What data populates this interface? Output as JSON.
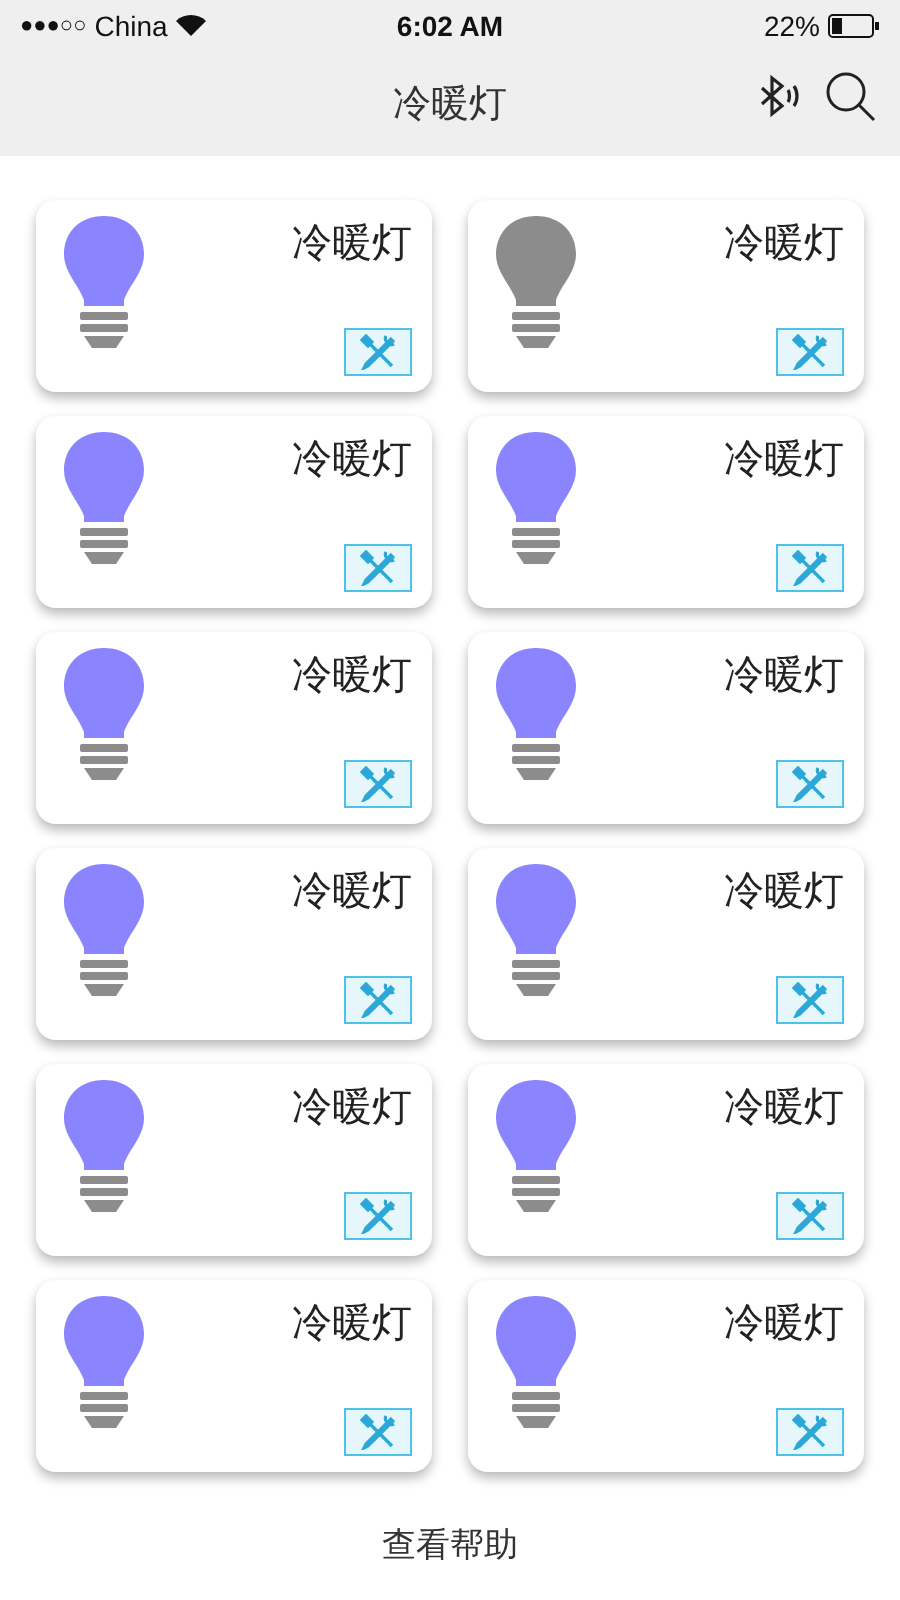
{
  "status_bar": {
    "signal": "●●●○○",
    "carrier": "China",
    "time": "6:02 AM",
    "battery": "22%"
  },
  "nav": {
    "title": "冷暖灯"
  },
  "devices": [
    {
      "name": "冷暖灯",
      "on": true
    },
    {
      "name": "冷暖灯",
      "on": false
    },
    {
      "name": "冷暖灯",
      "on": true
    },
    {
      "name": "冷暖灯",
      "on": true
    },
    {
      "name": "冷暖灯",
      "on": true
    },
    {
      "name": "冷暖灯",
      "on": true
    },
    {
      "name": "冷暖灯",
      "on": true
    },
    {
      "name": "冷暖灯",
      "on": true
    },
    {
      "name": "冷暖灯",
      "on": true
    },
    {
      "name": "冷暖灯",
      "on": true
    },
    {
      "name": "冷暖灯",
      "on": true
    },
    {
      "name": "冷暖灯",
      "on": true
    }
  ],
  "help_link": "查看帮助"
}
